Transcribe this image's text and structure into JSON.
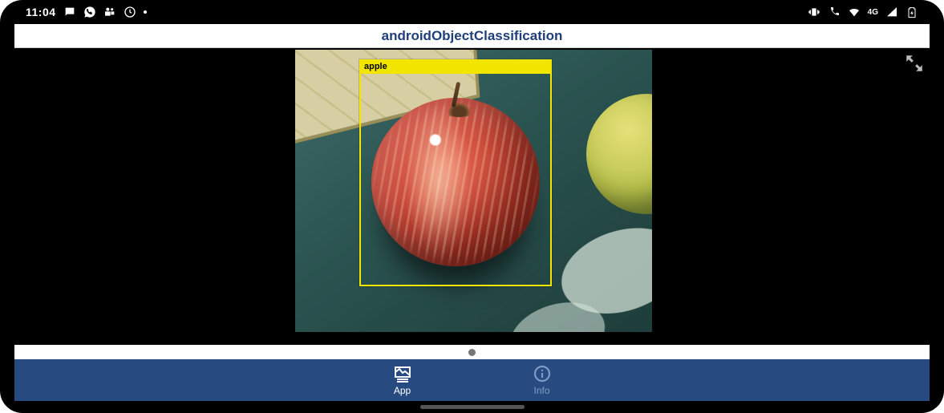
{
  "status": {
    "time": "11:04",
    "network_label": "4G"
  },
  "header": {
    "title": "androidObjectClassification"
  },
  "detection": {
    "label": "apple"
  },
  "tabs": {
    "app": {
      "label": "App"
    },
    "info": {
      "label": "Info"
    }
  }
}
